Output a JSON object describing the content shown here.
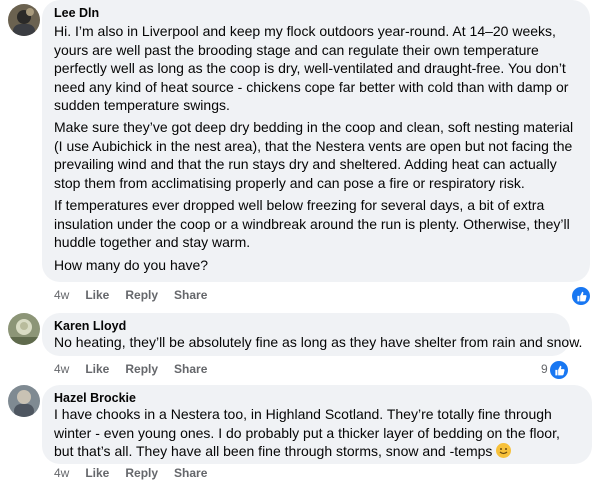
{
  "comments": [
    {
      "author": "Lee Dln",
      "paragraphs": [
        "Hi. I’m also in Liverpool and keep my flock outdoors year-round. At 14–20 weeks, yours are well past the brooding stage and can regulate their own temperature perfectly well as long as the coop is dry, well-ventilated and draught-free. You don’t need any kind of heat source - chickens cope far better with cold than with damp or sudden temperature swings.",
        "Make sure they’ve got deep dry bedding in the coop and clean, soft nesting material (I use Aubichick in the nest area), that the Nestera vents are open but not facing the prevailing wind and that the run stays dry and sheltered. Adding heat can actually stop them from acclimatising properly and can pose a fire or respiratory risk.",
        "If temperatures ever dropped well below freezing for several days, a bit of extra insulation under the coop or a windbreak around the run is plenty. Otherwise, they’ll huddle together and stay warm.",
        "How many do you have?"
      ],
      "time": "4w",
      "like": "Like",
      "reply": "Reply",
      "share": "Share"
    },
    {
      "author": "Karen Lloyd",
      "text": "No heating, they’ll be absolutely fine as long as they have shelter from rain and snow.",
      "time": "4w",
      "like": "Like",
      "reply": "Reply",
      "share": "Share",
      "reaction_count": "9"
    },
    {
      "author": "Hazel Brockie",
      "text": "I have chooks in a Nestera too, in Highland Scotland. They’re totally fine through winter - even young ones. I do probably put a thicker layer of bedding on the floor, but that’s all. They have all been fine through storms, snow and -temps",
      "time": "4w",
      "like": "Like",
      "reply": "Reply",
      "share": "Share"
    }
  ],
  "colors": {
    "bubble": "#f0f2f5",
    "meta": "#65676b",
    "like_blue": "#1877f2"
  },
  "icons": {
    "reaction": "thumbs-up-icon",
    "emoji": "smiling-face-emoji"
  }
}
